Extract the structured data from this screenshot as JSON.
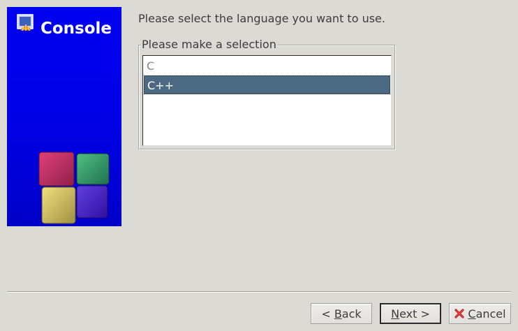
{
  "banner": {
    "title": "Console"
  },
  "prompt": "Please select the language you want to use.",
  "selection_group": {
    "label": "Please make a selection",
    "items": [
      {
        "label": "C",
        "selected": false
      },
      {
        "label": "C++",
        "selected": true
      }
    ]
  },
  "buttons": {
    "back": {
      "prefix": "< ",
      "mnemonic": "B",
      "rest": "ack"
    },
    "next": {
      "mnemonic": "N",
      "rest": "ext >"
    },
    "cancel": {
      "mnemonic": "C",
      "rest": "ancel"
    }
  },
  "colors": {
    "banner_blue": "#0000e4",
    "selection": "#4b6983",
    "window_bg": "#dcdad5"
  }
}
